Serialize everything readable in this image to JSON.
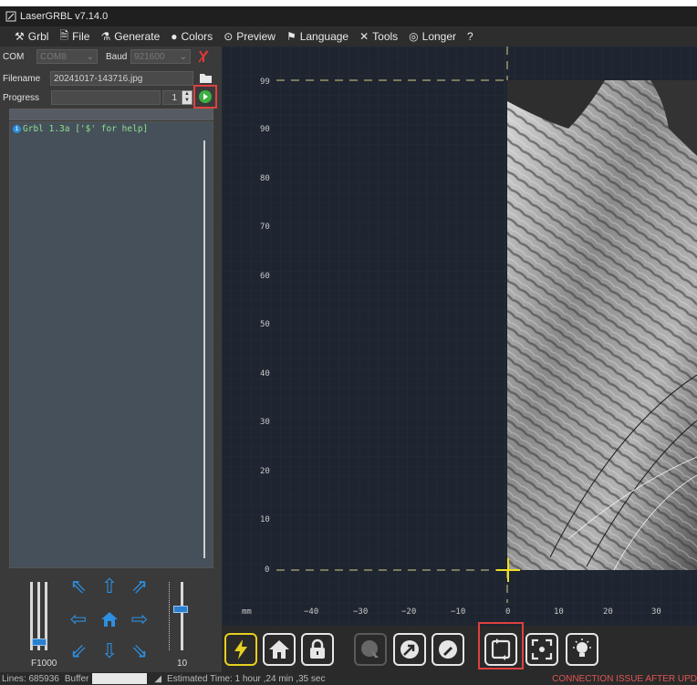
{
  "window": {
    "title": "LaserGRBL v7.14.0"
  },
  "menu": {
    "items": [
      {
        "label": "Grbl",
        "icon": "wrench-screwdriver-icon"
      },
      {
        "label": "File",
        "icon": "file-icon"
      },
      {
        "label": "Generate",
        "icon": "flask-icon"
      },
      {
        "label": "Colors",
        "icon": "palette-icon"
      },
      {
        "label": "Preview",
        "icon": "preview-icon"
      },
      {
        "label": "Language",
        "icon": "flag-icon"
      },
      {
        "label": "Tools",
        "icon": "tools-icon"
      },
      {
        "label": "Longer",
        "icon": "longer-icon"
      },
      {
        "label": "?",
        "icon": ""
      }
    ]
  },
  "connection": {
    "com_label": "COM",
    "com_value": "COM8",
    "baud_label": "Baud",
    "baud_value": "921600"
  },
  "file": {
    "filename_label": "Filename",
    "filename_value": "20241017-143716.jpg"
  },
  "progress": {
    "label": "Progress",
    "copies": "1"
  },
  "console": {
    "lines": [
      "Grbl 1.3a ['$' for help]"
    ]
  },
  "jog": {
    "speed_label": "F1000",
    "step_label": "10"
  },
  "status": {
    "lines_label": "Lines: 685936",
    "buffer_label": "Buffer",
    "estimated": "Estimated Time: 1 hour ,24 min ,35 sec",
    "warning": "CONNECTION ISSUE AFTER UPD"
  },
  "canvas": {
    "unit": "mm",
    "y_ticks": [
      "99",
      "90",
      "80",
      "70",
      "60",
      "50",
      "40",
      "30",
      "20",
      "10",
      "0"
    ],
    "x_ticks": [
      "−40",
      "−30",
      "−20",
      "−10",
      "0",
      "10",
      "20",
      "30"
    ]
  },
  "colors": {
    "accent": "#2d8fe0",
    "highlight": "#e04040",
    "laser_yellow": "#e6d020",
    "canvas_bg": "#1e2530"
  }
}
